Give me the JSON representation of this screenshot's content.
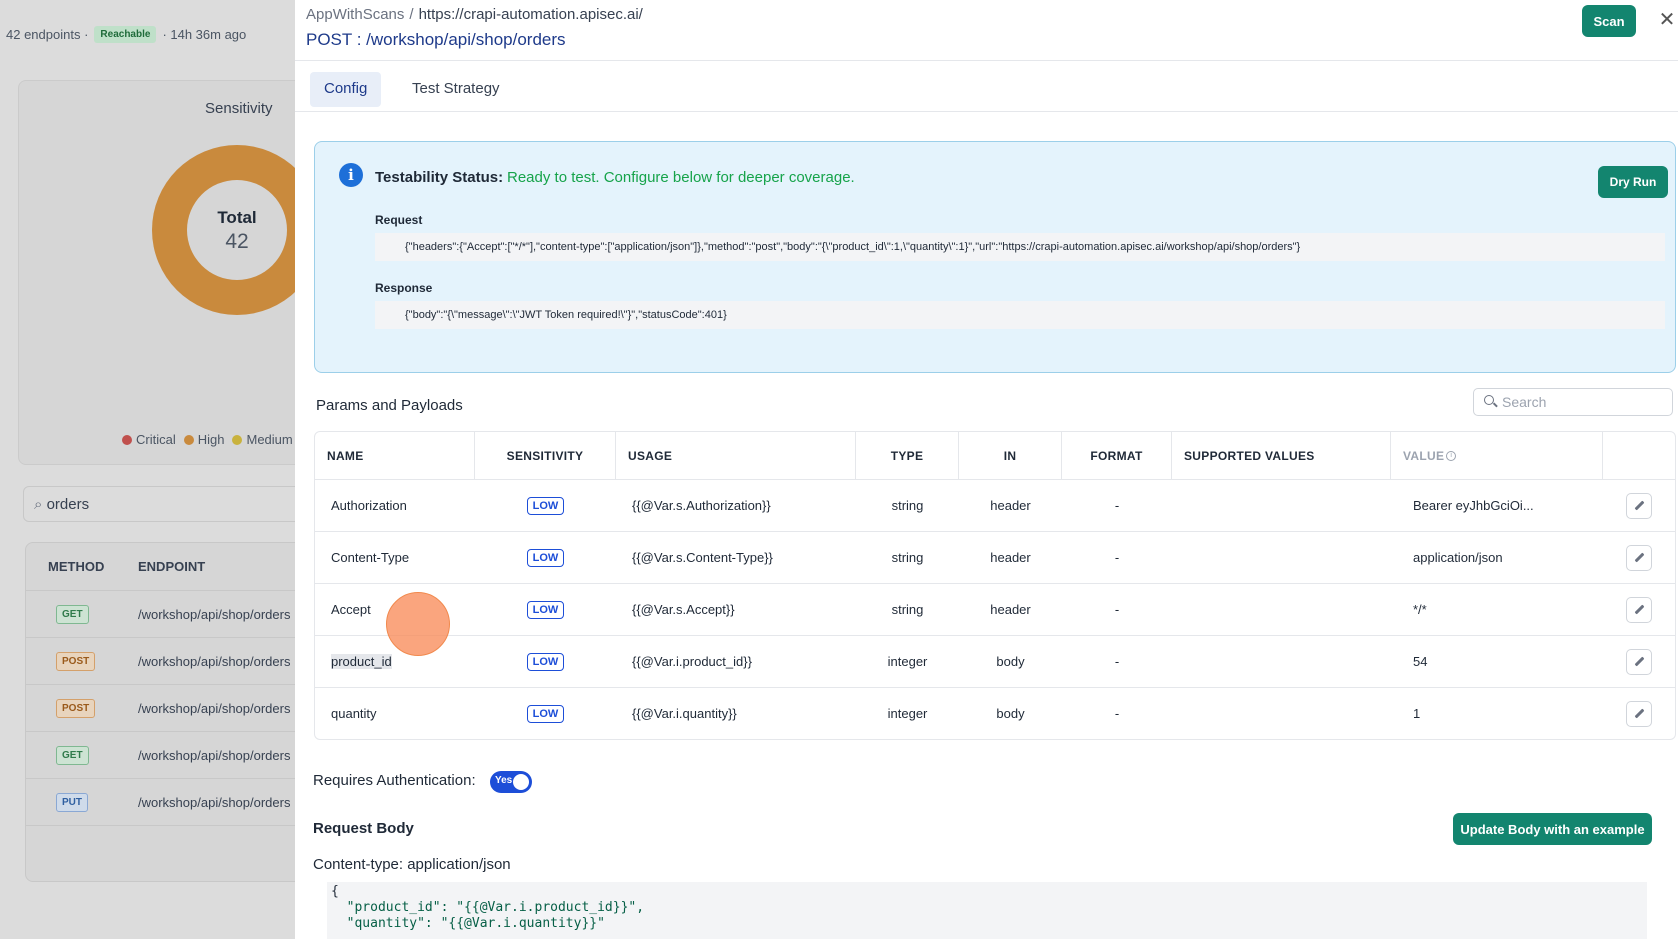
{
  "background": {
    "endpoint_count": "42 endpoints ·",
    "reachable_badge": "Reachable",
    "last_scan": "· 14h 36m ago",
    "sensitivity_title": "Sensitivity",
    "donut_total_label": "Total",
    "donut_total_value": "42",
    "legend": [
      {
        "label": "Critical",
        "color": "#c0504d"
      },
      {
        "label": "High",
        "color": "#c98a3d"
      },
      {
        "label": "Medium",
        "color": "#c9b23d"
      }
    ],
    "search_value": "orders",
    "table_headers": [
      "METHOD",
      "ENDPOINT"
    ],
    "rows": [
      {
        "method": "GET",
        "endpoint": "/workshop/api/shop/orders"
      },
      {
        "method": "POST",
        "endpoint": "/workshop/api/shop/orders"
      },
      {
        "method": "POST",
        "endpoint": "/workshop/api/shop/orders"
      },
      {
        "method": "GET",
        "endpoint": "/workshop/api/shop/orders"
      },
      {
        "method": "PUT",
        "endpoint": "/workshop/api/shop/orders"
      }
    ]
  },
  "drawer": {
    "breadcrumb_app": "AppWithScans",
    "breadcrumb_sep": "/",
    "breadcrumb_url": "https://crapi-automation.apisec.ai/",
    "endpoint_title": "POST :  /workshop/api/shop/orders",
    "scan_label": "Scan",
    "close_glyph": "✕",
    "tabs": [
      {
        "label": "Config"
      },
      {
        "label": "Test Strategy"
      }
    ],
    "status": {
      "label": "Testability Status:",
      "text": "Ready to test. Configure below for deeper coverage.",
      "dry_run_label": "Dry Run",
      "request_label": "Request",
      "request_value": "{\"headers\":{\"Accept\":[\"*/*\"],\"content-type\":[\"application/json\"]},\"method\":\"post\",\"body\":\"{\\\"product_id\\\":1,\\\"quantity\\\":1}\",\"url\":\"https://crapi-automation.apisec.ai/workshop/api/shop/orders\"}",
      "response_label": "Response",
      "response_value": "{\"body\":\"{\\\"message\\\":\\\"JWT Token required!\\\"}\",\"statusCode\":401}"
    },
    "params": {
      "title": "Params and Payloads",
      "search_placeholder": "Search",
      "headers": [
        "NAME",
        "SENSITIVITY",
        "USAGE",
        "TYPE",
        "IN",
        "FORMAT",
        "SUPPORTED VALUES",
        "VALUE"
      ],
      "rows": [
        {
          "name": "Authorization",
          "sensitivity": "LOW",
          "usage": "{{@Var.s.Authorization}}",
          "type": "string",
          "in": "header",
          "format": "-",
          "supported": "",
          "value": "Bearer eyJhbGciOi..."
        },
        {
          "name": "Content-Type",
          "sensitivity": "LOW",
          "usage": "{{@Var.s.Content-Type}}",
          "type": "string",
          "in": "header",
          "format": "-",
          "supported": "",
          "value": "application/json"
        },
        {
          "name": "Accept",
          "sensitivity": "LOW",
          "usage": "{{@Var.s.Accept}}",
          "type": "string",
          "in": "header",
          "format": "-",
          "supported": "",
          "value": "*/*"
        },
        {
          "name": "product_id",
          "sensitivity": "LOW",
          "usage": "{{@Var.i.product_id}}",
          "type": "integer",
          "in": "body",
          "format": "-",
          "supported": "",
          "value": "54"
        },
        {
          "name": "quantity",
          "sensitivity": "LOW",
          "usage": "{{@Var.i.quantity}}",
          "type": "integer",
          "in": "body",
          "format": "-",
          "supported": "",
          "value": "1"
        }
      ]
    },
    "auth": {
      "label": "Requires Authentication:",
      "toggle_text": "Yes",
      "enabled": true
    },
    "request_body": {
      "title": "Request Body",
      "update_label": "Update Body with an example",
      "content_type": "Content-type: application/json",
      "open_brace": "{",
      "line1": "  \"product_id\": \"{{@Var.i.product_id}}\",",
      "line2": "  \"quantity\": \"{{@Var.i.quantity}}\""
    }
  },
  "colors": {
    "primary_button": "#13856f",
    "link_blue": "#1e3a8a",
    "badge_blue": "#1d4ed8",
    "status_green": "#16a34a",
    "info_panel": "#e4f3fc"
  }
}
